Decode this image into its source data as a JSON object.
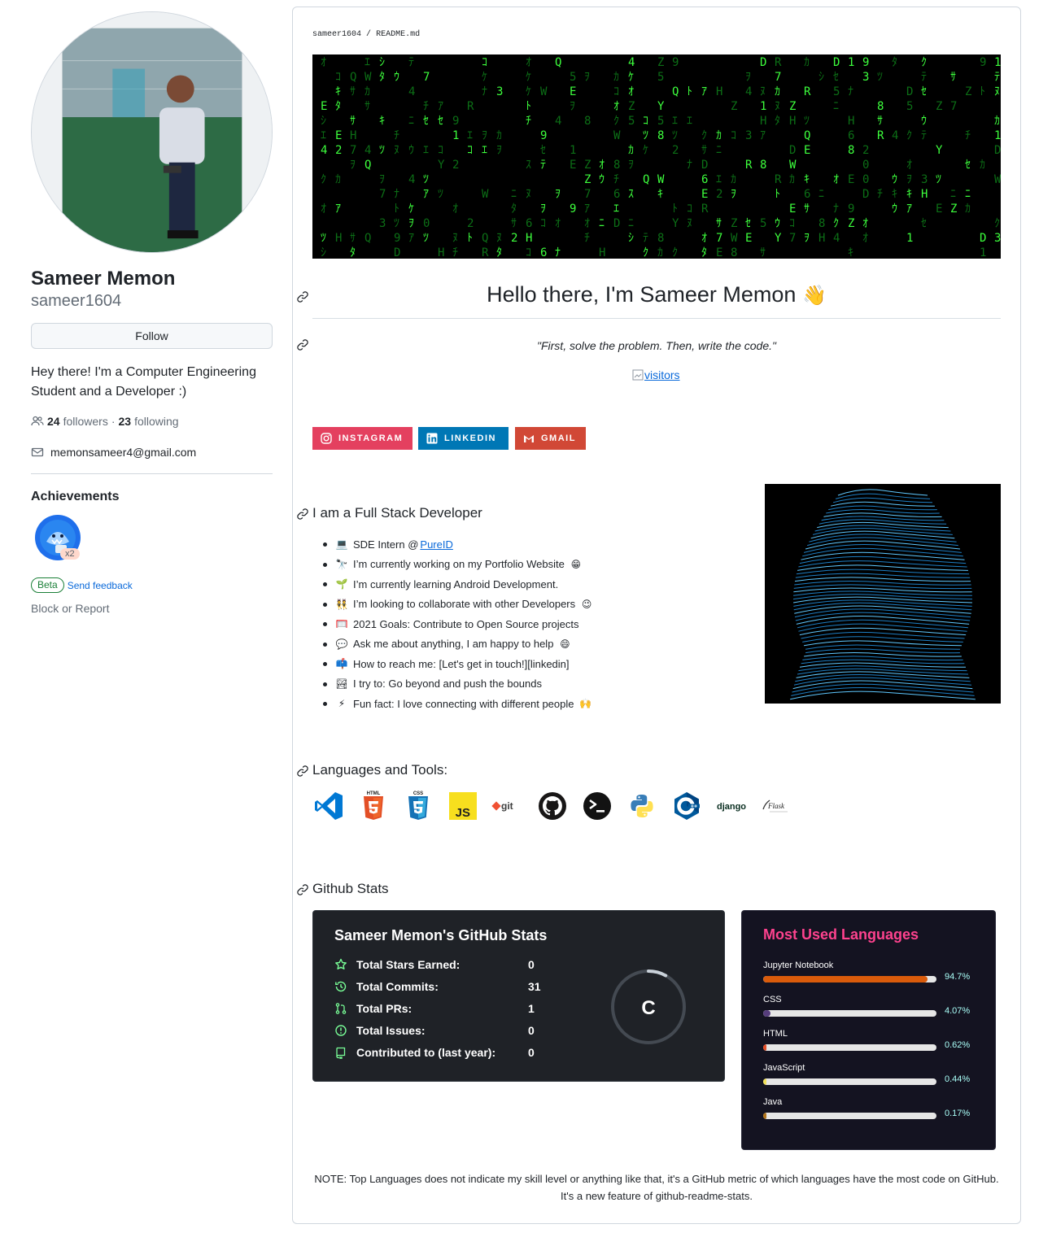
{
  "profile": {
    "name": "Sameer Memon",
    "login": "sameer1604",
    "follow_label": "Follow",
    "bio": "Hey there! I'm a Computer Engineering Student and a Developer :)",
    "followers_count": "24",
    "followers_label": "followers",
    "separator": "·",
    "following_count": "23",
    "following_label": "following",
    "email": "memonsameer4@gmail.com",
    "achievements_title": "Achievements",
    "achievement_multiplier": "x2",
    "beta_label": "Beta",
    "feedback_label": "Send feedback",
    "block_label": "Block or Report"
  },
  "readme": {
    "breadcrumb_user": "sameer1604",
    "breadcrumb_sep": "/",
    "breadcrumb_file": "README",
    "breadcrumb_ext": ".md",
    "greeting": "Hello there, I'm Sameer Memon",
    "greeting_emoji": "👋",
    "quote": "\"First, solve the problem. Then, write the code.\"",
    "visitors_alt": "visitors",
    "social": [
      {
        "label": "INSTAGRAM",
        "color": "#e4405f"
      },
      {
        "label": "LINKEDIN",
        "color": "#0077b5"
      },
      {
        "label": "GMAIL",
        "color": "#d14836"
      }
    ],
    "about_heading": "I am a Full Stack Developer",
    "about_items": [
      {
        "emoji": "💻",
        "text": "SDE Intern @ ",
        "link": "PureID"
      },
      {
        "emoji": "🔭",
        "text": "I’m currently working on my Portfolio Website",
        "trail": "😁"
      },
      {
        "emoji": "🌱",
        "text": "I’m currently learning Android Development."
      },
      {
        "emoji": "👯",
        "text": "I’m looking to collaborate with other Developers",
        "trail": "😉"
      },
      {
        "emoji": "🥅",
        "text": "2021 Goals: Contribute to Open Source projects"
      },
      {
        "emoji": "💬",
        "text": "Ask me about anything, I am happy to help",
        "trail": "😄"
      },
      {
        "emoji": "📫",
        "text": "How to reach me: [Let's get in touch!][linkedin]"
      },
      {
        "emoji": "🏞",
        "text": "I try to: Go beyond and push the bounds"
      },
      {
        "emoji": "⚡",
        "text": "Fun fact: I love connecting with different people",
        "trail": "🙌"
      }
    ],
    "tools_heading": "Languages and Tools:",
    "tools": [
      "vscode-icon",
      "html5-icon",
      "css3-icon",
      "javascript-icon",
      "git-icon",
      "github-icon",
      "terminal-icon",
      "python-icon",
      "cplusplus-icon",
      "django-icon",
      "flask-icon"
    ],
    "tool_labels": {
      "js": "JS",
      "git": "git",
      "django": "django",
      "flask": "Flask"
    },
    "stats_heading": "Github Stats",
    "stats_card": {
      "title": "Sameer Memon's GitHub Stats",
      "rows": [
        {
          "label": "Total Stars Earned:",
          "value": "0",
          "icon": "star-icon"
        },
        {
          "label": "Total Commits:",
          "value": "31",
          "icon": "history-icon"
        },
        {
          "label": "Total PRs:",
          "value": "1",
          "icon": "pull-request-icon"
        },
        {
          "label": "Total Issues:",
          "value": "0",
          "icon": "issue-icon"
        },
        {
          "label": "Contributed to (last year):",
          "value": "0",
          "icon": "repo-icon"
        }
      ],
      "grade": "C",
      "grade_progress": 0.08,
      "accent": "#2f80ed"
    },
    "languages_card": {
      "title": "Most Used Languages",
      "title_color": "#fe428e",
      "text_color": "#a9fef7",
      "items": [
        {
          "name": "Jupyter Notebook",
          "percent": "94.7%",
          "value": 94.7,
          "color": "#DA5B0B"
        },
        {
          "name": "CSS",
          "percent": "4.07%",
          "value": 4.07,
          "color": "#563d7c"
        },
        {
          "name": "HTML",
          "percent": "0.62%",
          "value": 0.62,
          "color": "#e34c26"
        },
        {
          "name": "JavaScript",
          "percent": "0.44%",
          "value": 0.44,
          "color": "#f1e05a"
        },
        {
          "name": "Java",
          "percent": "0.17%",
          "value": 0.17,
          "color": "#b07219"
        }
      ]
    },
    "note": "NOTE: Top Languages does not indicate my skill level or anything like that, it's a GitHub metric of which languages have the most code on GitHub. It's a new feature of github-readme-stats."
  }
}
